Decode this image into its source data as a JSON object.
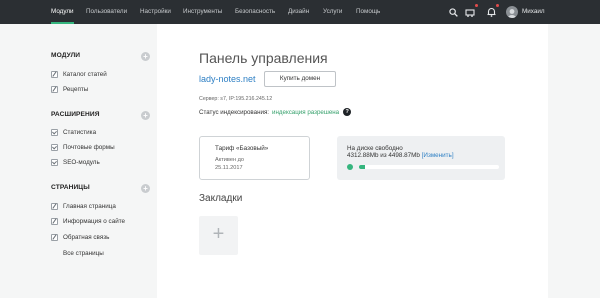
{
  "topbar": {
    "nav": [
      "Модули",
      "Пользователи",
      "Настройки",
      "Инструменты",
      "Безопасность",
      "Дизайн",
      "Услуги",
      "Помощь"
    ],
    "active_index": 0,
    "icons": [
      "search-icon",
      "cart-icon",
      "bell-icon"
    ],
    "user_name": "Михаил",
    "colors": {
      "bar": "#2b2f33",
      "accent": "#35b57e",
      "badge": "#e24b4b"
    }
  },
  "sidebar": {
    "sections": [
      {
        "title": "МОДУЛИ",
        "items": [
          "Каталог статей",
          "Рецепты"
        ]
      },
      {
        "title": "РАСШИРЕНИЯ",
        "items": [
          "Статистика",
          "Почтовые формы",
          "SEO-модуль"
        ]
      },
      {
        "title": "СТРАНИЦЫ",
        "items": [
          "Главная страница",
          "Информация о сайте",
          "Обратная связь",
          "Все страницы"
        ]
      }
    ],
    "add_symbol": "+"
  },
  "main": {
    "title": "Панель управления",
    "site": "lady-notes.net",
    "buy_domain": "Купить домен",
    "server": "Сервер: s7, IP:195.216.245.12",
    "status_label": "Статус индексирования:",
    "status_value": "индексация разрешена",
    "help": "?",
    "tariff": {
      "name": "Тариф «Базовый»",
      "active_label": "Активен до",
      "active_date": "25.11.2017"
    },
    "disk": {
      "label": "На диске свободно",
      "value": "4312.88Mb из 4498.87Mb",
      "change": "[Изменить]",
      "usage_fraction": 0.04
    },
    "bookmarks_title": "Закладки",
    "add_bookmark": "+"
  }
}
